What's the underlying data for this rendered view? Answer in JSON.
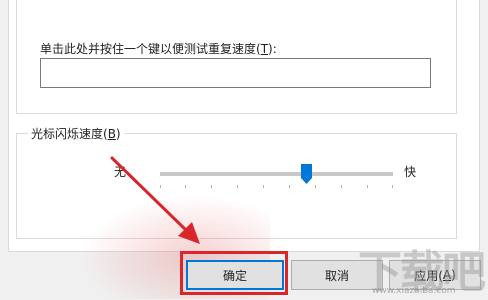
{
  "repeat_test": {
    "label": "单击此处并按住一个键以便测试重复速度(",
    "accel": "T",
    "label_end": "):",
    "value": ""
  },
  "cursor_blink": {
    "legend": "光标闪烁速度(",
    "accel": "B",
    "legend_end": ")",
    "slow_label": "无",
    "fast_label": "快",
    "level_fraction": 0.63
  },
  "buttons": {
    "ok": "确定",
    "cancel": "取消",
    "apply_prefix": "应用(",
    "apply_accel": "A",
    "apply_suffix": ")"
  },
  "annotation": {
    "highlight_color": "#d8262b",
    "arrow_color": "#d8262b"
  },
  "watermark": {
    "big_text": "下载吧",
    "url": "www.xiazaiba.com"
  }
}
